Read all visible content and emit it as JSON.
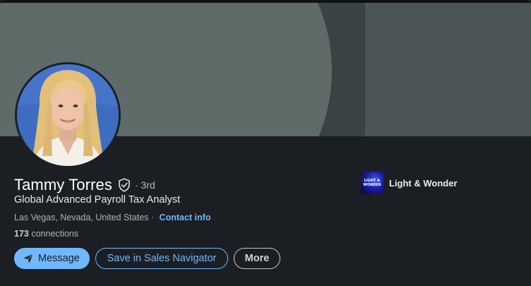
{
  "profile": {
    "name": "Tammy Torres",
    "degree": "· 3rd",
    "headline": "Global Advanced Payroll Tax Analyst",
    "location": "Las Vegas, Nevada, United States",
    "location_separator": "·",
    "contact_label": "Contact info",
    "connections_count": "173",
    "connections_label": "connections"
  },
  "actions": {
    "message_label": "Message",
    "sales_navigator_label": "Save in Sales Navigator",
    "more_label": "More"
  },
  "company": {
    "name": "Light & Wonder",
    "logo_text": "LIGHT & WONDER"
  },
  "icons": {
    "verified": "shield-check-icon",
    "message": "send-icon"
  },
  "colors": {
    "background": "#1b1f23",
    "accent": "#71b7fb",
    "banner": "#5f6b69"
  }
}
